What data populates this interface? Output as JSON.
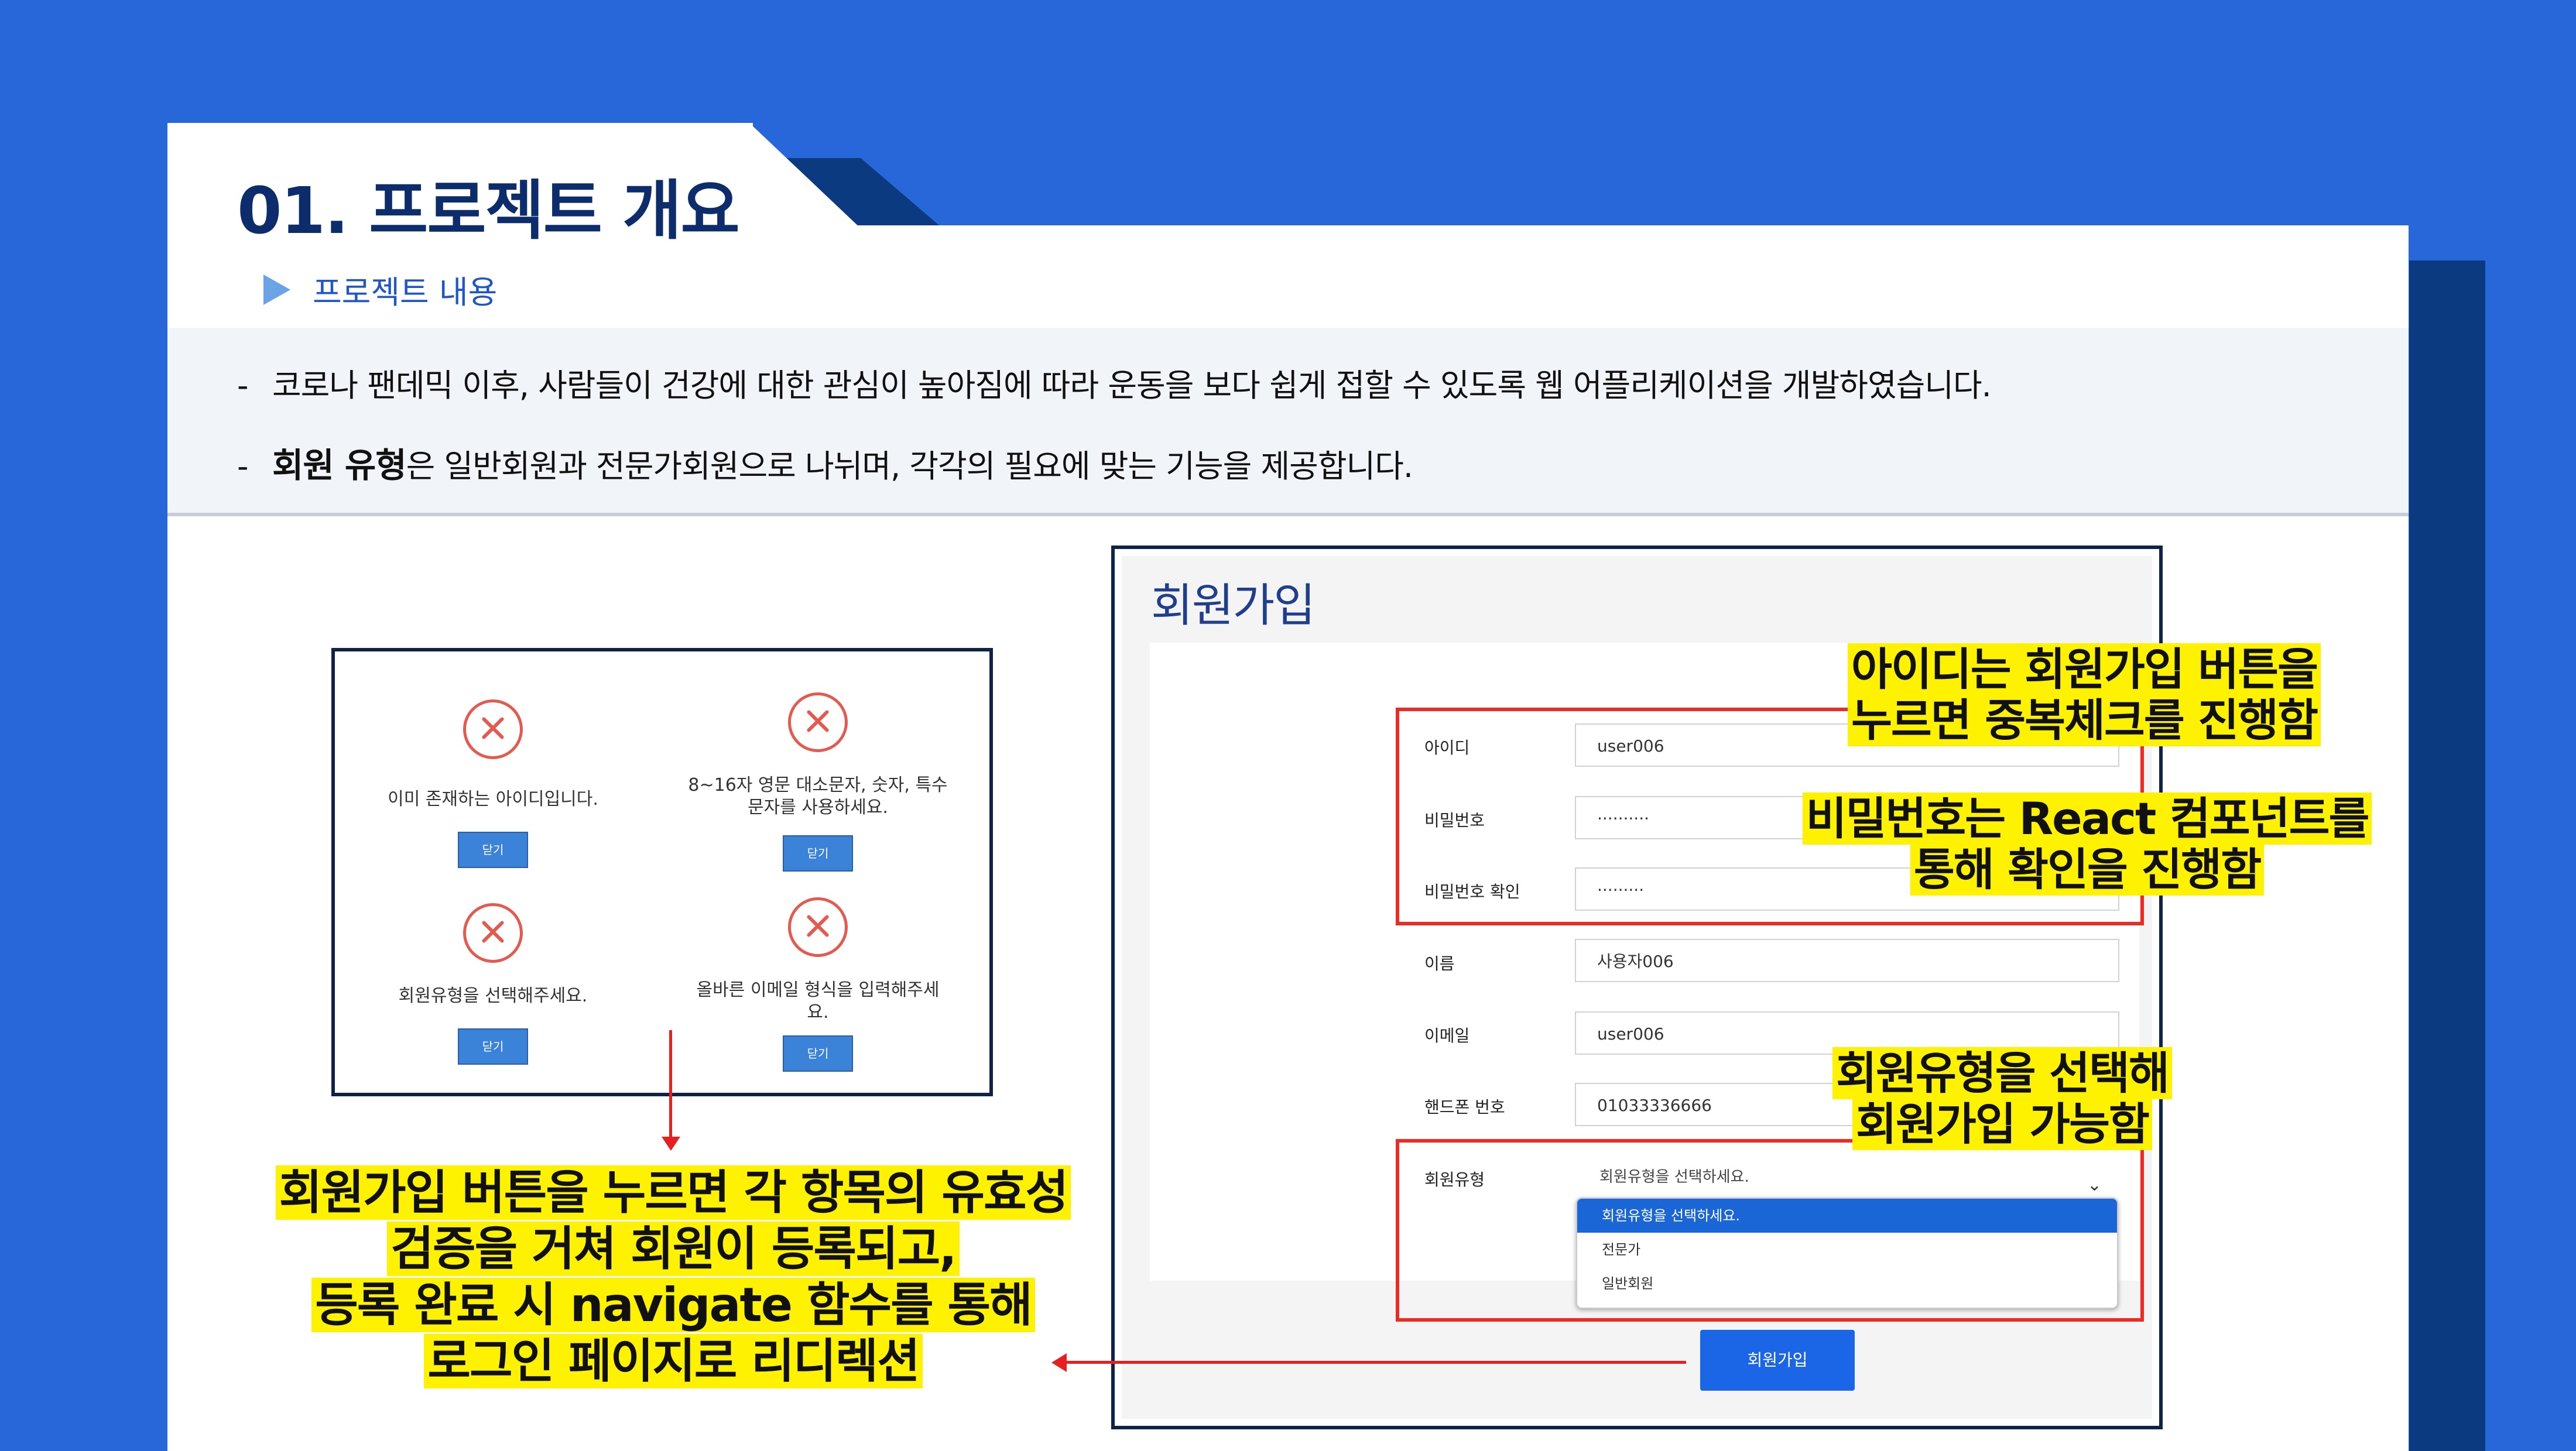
{
  "header": {
    "title": "01. 프로젝트 개요",
    "subtitle": "프로젝트 내용"
  },
  "summary": {
    "line1": "코로나 팬데믹 이후, 사람들이 건강에 대한 관심이 높아짐에 따라 운동을 보다 쉽게 접할 수 있도록 웹 어플리케이션을 개발하였습니다.",
    "line2_bold": "회원 유형",
    "line2_rest": "은  일반회원과 전문가회원으로 나뉘며, 각각의 필요에 맞는 기능을 제공합니다."
  },
  "errors": [
    {
      "message": "이미 존재하는 아이디입니다.",
      "button": "닫기"
    },
    {
      "message": "8~16자 영문 대소문자, 숫자, 특수문자를 사용하세요.",
      "button": "닫기"
    },
    {
      "message": "회원유형을 선택해주세요.",
      "button": "닫기"
    },
    {
      "message": "올바른 이메일 형식을 입력해주세요.",
      "button": "닫기"
    }
  ],
  "signup": {
    "title": "회원가입",
    "fields": [
      {
        "label": "아이디",
        "value": "user006"
      },
      {
        "label": "비밀번호",
        "value": "··········"
      },
      {
        "label": "비밀번호 확인",
        "value": "·········"
      },
      {
        "label": "이름",
        "value": "사용자006"
      },
      {
        "label": "이메일",
        "value": "user006"
      },
      {
        "label": "핸드폰 번호",
        "value": "01033336666"
      },
      {
        "label": "회원유형",
        "value": "회원유형을 선택하세요."
      }
    ],
    "options": [
      "회원유형을 선택하세요.",
      "전문가",
      "일반회원"
    ],
    "submit": "회원가입"
  },
  "annotations": {
    "id_check": [
      "아이디는 회원가입 버튼을",
      "누르면 중복체크를 진행함"
    ],
    "password": [
      "비밀번호는 React 컴포넌트를",
      "통해 확인을 진행함"
    ],
    "member_type": [
      "회원유형을 선택해",
      "회원가입 가능함"
    ],
    "validation": [
      "회원가입 버튼을 누르면 각 항목의 유효성",
      "검증을 거쳐 회원이 등록되고,",
      "등록 완료 시 navigate 함수를 통해",
      "로그인 페이지로 리디렉션"
    ]
  },
  "colors": {
    "background": "#2767d9",
    "navy": "#0b3a80",
    "highlight": "#fff200",
    "red": "#ee2a24",
    "button": "#1a66e6"
  }
}
